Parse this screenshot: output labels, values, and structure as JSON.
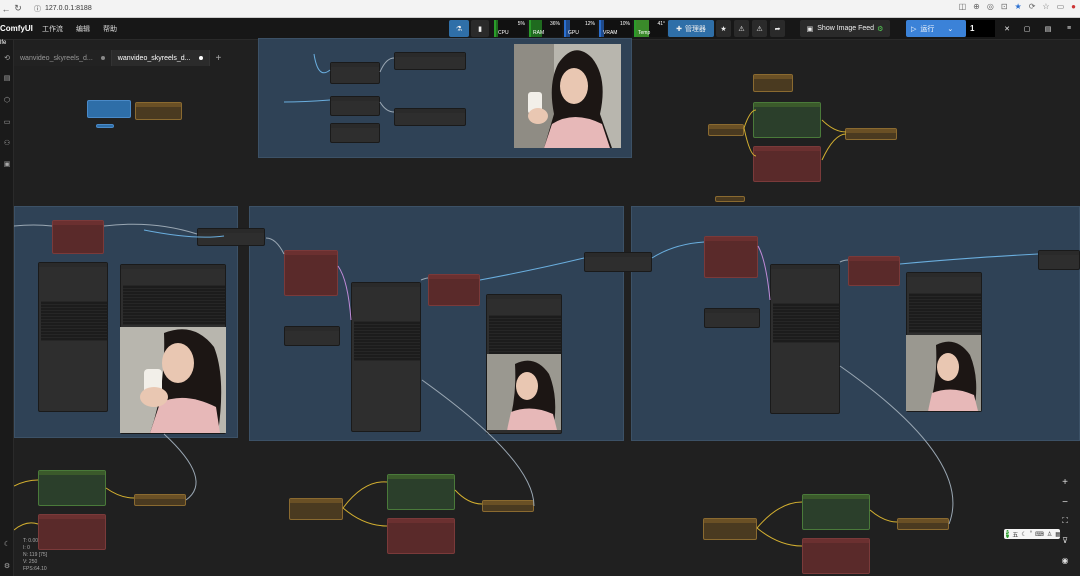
{
  "browser": {
    "url": "127.0.0.1:8188"
  },
  "app": {
    "brand": "ComfyUI",
    "menus": [
      "工作流",
      "编辑",
      "帮助"
    ],
    "manager_label": "管理器",
    "image_feed_label": "Show Image Feed",
    "run_label": "运行",
    "queue_count": "1"
  },
  "monitor": {
    "cpu": {
      "label": "CPU",
      "value": "5%",
      "fraction": 0.05
    },
    "ram": {
      "label": "RAM",
      "value": "36%",
      "fraction": 0.36
    },
    "gpu": {
      "label": "GPU",
      "value": "12%",
      "fraction": 0.12
    },
    "vram": {
      "label": "VRAM",
      "value": "10%",
      "fraction": 0.1
    },
    "temp": {
      "label": "Temp",
      "value": "41°",
      "fraction": 0.41
    }
  },
  "sidebar_top_label": "lfe",
  "tabs": [
    {
      "label": "wanvideo_skyreels_d...",
      "active": false
    },
    {
      "label": "wanvideo_skyreels_d...",
      "active": true
    }
  ],
  "stats": {
    "t": "T: 0.00",
    "i": "I: 0",
    "n": "N: 119 [75]",
    "v": "V: 250",
    "fps": "FPS:64.10"
  },
  "ime": {
    "label": "五"
  },
  "colors": {
    "group": "#2f4256",
    "node_red": "#5a2a2a",
    "node_green": "#2b3f2b",
    "node_gold": "#4a3a20",
    "accent_blue": "#3b82d8",
    "link_yellow": "#d4b030",
    "link_blue": "#6aaede",
    "link_gray": "#9aa7b3"
  }
}
